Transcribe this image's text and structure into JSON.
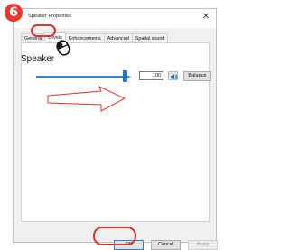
{
  "step": {
    "number": "6"
  },
  "window": {
    "title": "Speaker Properties",
    "close_glyph": "✕"
  },
  "tabs": [
    {
      "label": "General",
      "active": false
    },
    {
      "label": "Levels",
      "active": true
    },
    {
      "label": "Enhancements",
      "active": false
    },
    {
      "label": "Advanced",
      "active": false
    },
    {
      "label": "Spatial sound",
      "active": false
    }
  ],
  "levels": {
    "device_label": "Speaker",
    "volume_value": "100",
    "volume_fraction": 1.0,
    "speaker_icon": "speaker-icon",
    "balance_label": "Balance"
  },
  "footer": {
    "ok_label": "OK",
    "cancel_label": "Cancel",
    "apply_label": "Apply"
  },
  "colors": {
    "highlight": "#e0352c",
    "accent": "#1f71c4",
    "badge": "#e8372e"
  },
  "overlays": {
    "mouse_icon": "mouse-icon",
    "arrow_icon": "arrow-right-outline-icon"
  }
}
